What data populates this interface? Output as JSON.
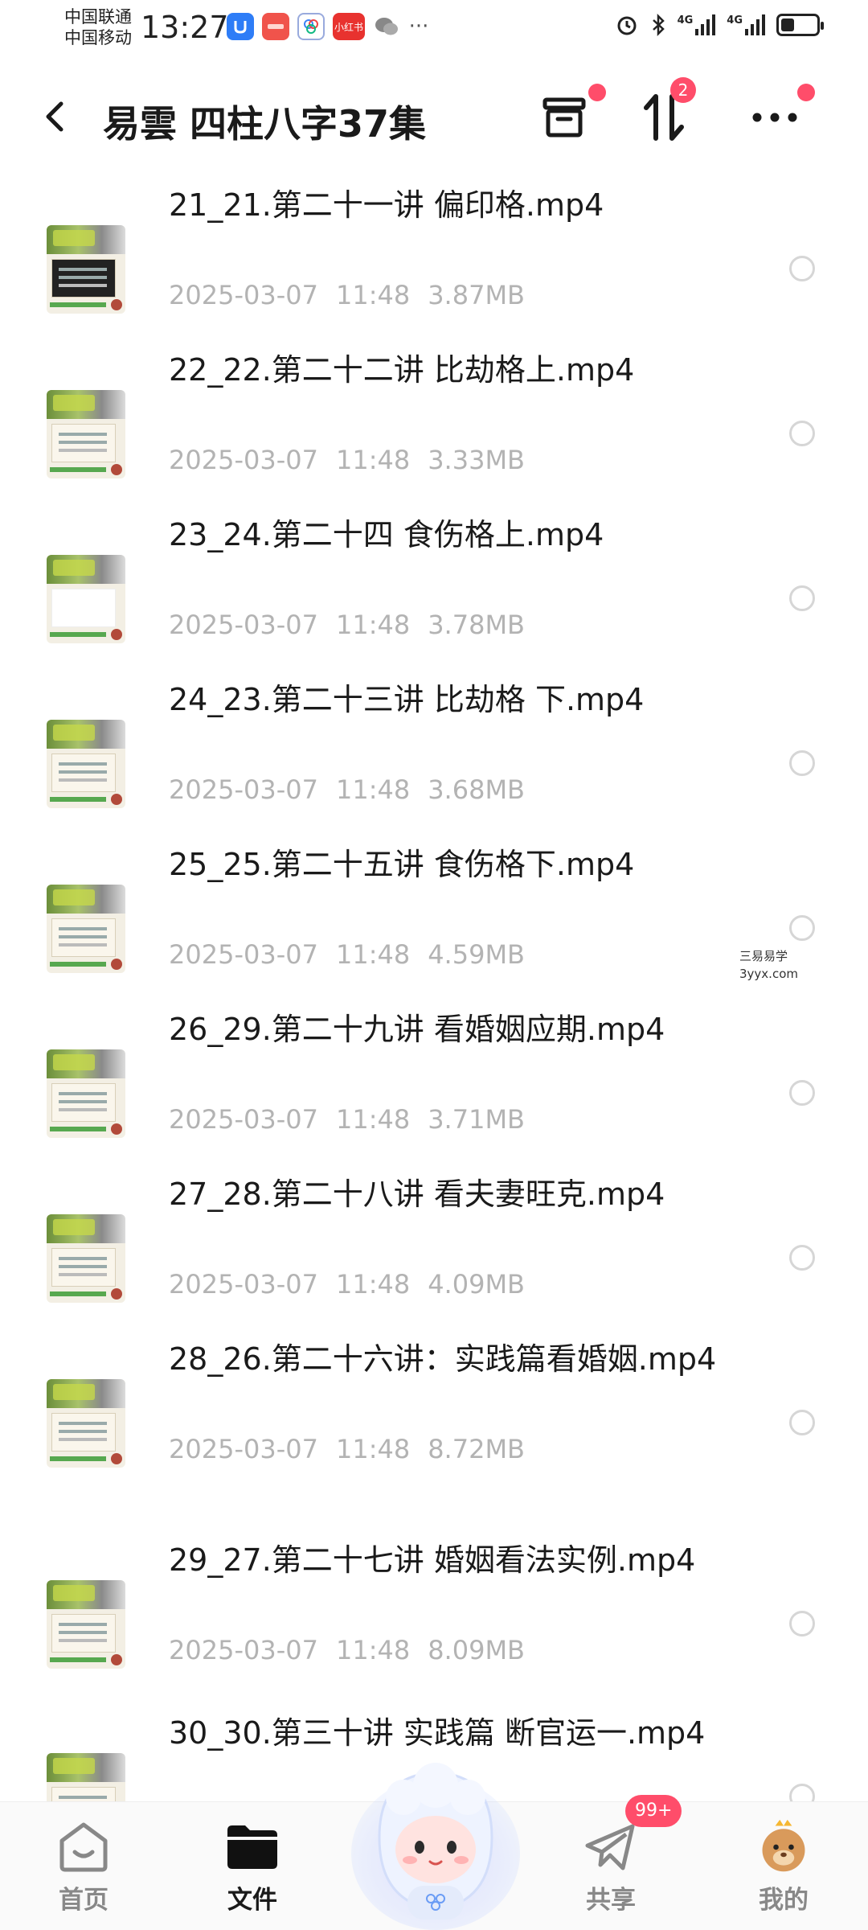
{
  "status_bar": {
    "carrier_1": "中国联通",
    "carrier_2": "中国移动",
    "time": "13:27",
    "xhs_label": "小红书",
    "signal_label_1": "4G",
    "signal_label_2": "4G"
  },
  "header": {
    "title": "易雲 四柱八字37集",
    "sort_badge": "2"
  },
  "files": [
    {
      "name": "21_21.第二十一讲 偏印格.mp4",
      "date": "2025-03-07",
      "time": "11:48",
      "size": "3.87MB",
      "thumb": "dark"
    },
    {
      "name": "22_22.第二十二讲 比劫格上.mp4",
      "date": "2025-03-07",
      "time": "11:48",
      "size": "3.33MB",
      "thumb": "normal"
    },
    {
      "name": "23_24.第二十四 食伤格上.mp4",
      "date": "2025-03-07",
      "time": "11:48",
      "size": "3.78MB",
      "thumb": "plain"
    },
    {
      "name": "24_23.第二十三讲 比劫格 下.mp4",
      "date": "2025-03-07",
      "time": "11:48",
      "size": "3.68MB",
      "thumb": "normal"
    },
    {
      "name": "25_25.第二十五讲 食伤格下.mp4",
      "date": "2025-03-07",
      "time": "11:48",
      "size": "4.59MB",
      "thumb": "normal"
    },
    {
      "name": "26_29.第二十九讲 看婚姻应期.mp4",
      "date": "2025-03-07",
      "time": "11:48",
      "size": "3.71MB",
      "thumb": "normal"
    },
    {
      "name": "27_28.第二十八讲 看夫妻旺克.mp4",
      "date": "2025-03-07",
      "time": "11:48",
      "size": "4.09MB",
      "thumb": "normal"
    },
    {
      "name": "28_26.第二十六讲：实践篇看婚姻.mp4",
      "date": "2025-03-07",
      "time": "11:48",
      "size": "8.72MB",
      "thumb": "normal"
    },
    {
      "name": "29_27.第二十七讲 婚姻看法实例.mp4",
      "date": "2025-03-07",
      "time": "11:48",
      "size": "8.09MB",
      "thumb": "normal"
    },
    {
      "name": "30_30.第三十讲 实践篇 断官运一.mp4",
      "date": "",
      "time": "",
      "size": "",
      "thumb": "normal"
    }
  ],
  "watermark": {
    "line1": "三易易学",
    "line2": "3yyx.com"
  },
  "bottom_nav": {
    "home": "首页",
    "files": "文件",
    "share": "共享",
    "mine": "我的",
    "share_badge": "99+"
  },
  "colors": {
    "accent_red": "#ff4d6a",
    "meta_gray": "#b3b3b3"
  }
}
